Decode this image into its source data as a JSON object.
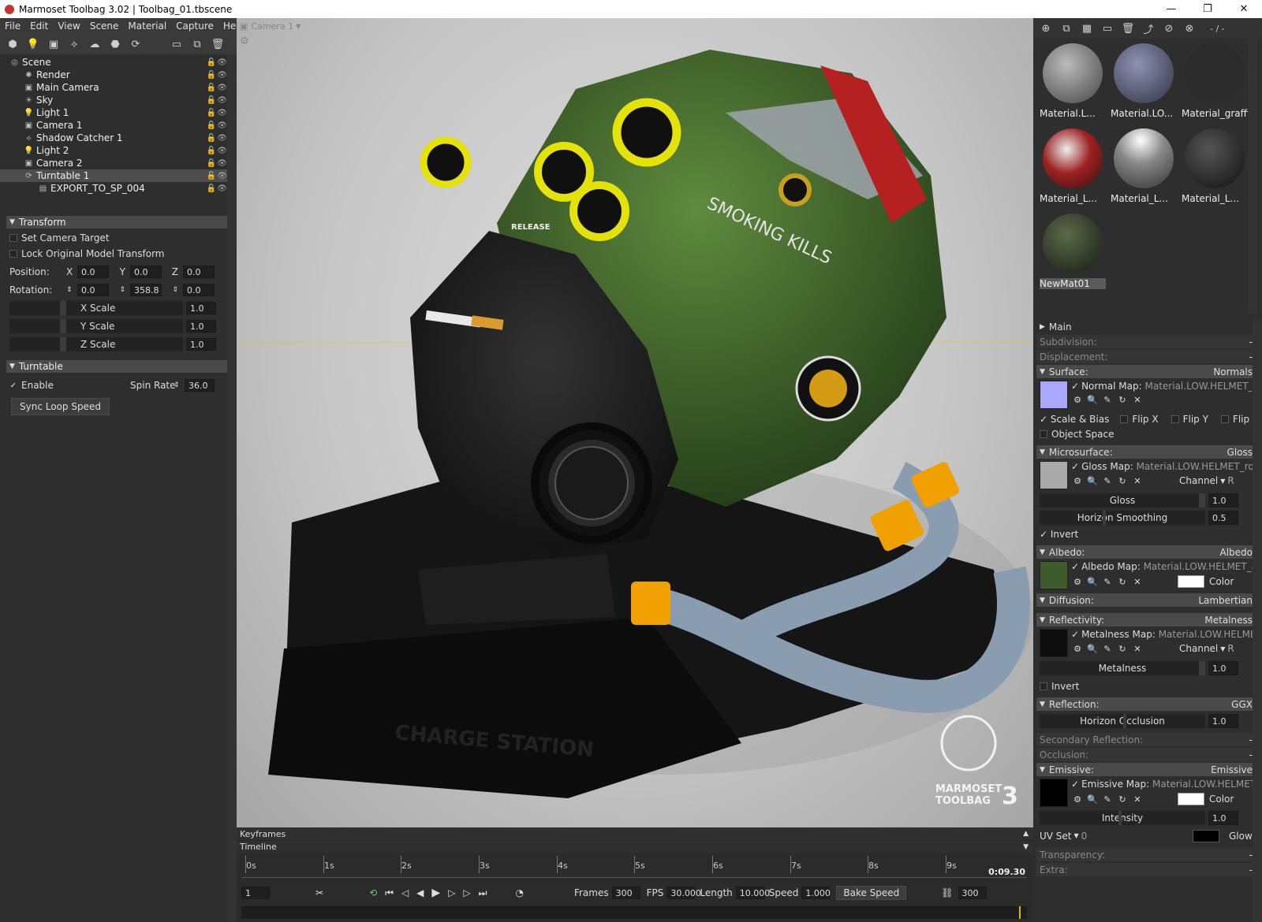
{
  "window": {
    "title": "Marmoset Toolbag 3.02  |  Toolbag_01.tbscene",
    "min": "—",
    "max": "❐",
    "close": "✕"
  },
  "menu": [
    "File",
    "Edit",
    "View",
    "Scene",
    "Material",
    "Capture",
    "Help"
  ],
  "scene_tree": [
    {
      "label": "Scene",
      "depth": 0,
      "icon": "scene-icon"
    },
    {
      "label": "Render",
      "depth": 1,
      "icon": "render-icon"
    },
    {
      "label": "Main Camera",
      "depth": 1,
      "icon": "camera-icon"
    },
    {
      "label": "Sky",
      "depth": 1,
      "icon": "sky-icon"
    },
    {
      "label": "Light 1",
      "depth": 1,
      "icon": "light-icon"
    },
    {
      "label": "Camera 1",
      "depth": 1,
      "icon": "camera-icon"
    },
    {
      "label": "Shadow Catcher 1",
      "depth": 1,
      "icon": "shadow-catcher-icon"
    },
    {
      "label": "Light 2",
      "depth": 1,
      "icon": "light-icon"
    },
    {
      "label": "Camera 2",
      "depth": 1,
      "icon": "camera-icon"
    },
    {
      "label": "Turntable 1",
      "depth": 1,
      "icon": "turntable-icon",
      "selected": true
    },
    {
      "label": "EXPORT_TO_SP_004",
      "depth": 2,
      "icon": "mesh-icon"
    }
  ],
  "transform": {
    "header": "Transform",
    "set_camera_target": "Set Camera Target",
    "lock_original": "Lock Original Model Transform",
    "position_label": "Position:",
    "rotation_label": "Rotation:",
    "x": "X",
    "y": "Y",
    "z": "Z",
    "position": [
      "0.0",
      "0.0",
      "0.0"
    ],
    "rotation": [
      "0.0",
      "358.8",
      "0.0"
    ],
    "x_scale_label": "X Scale",
    "x_scale": "1.0",
    "y_scale_label": "Y Scale",
    "y_scale": "1.0",
    "z_scale_label": "Z Scale",
    "z_scale": "1.0"
  },
  "turntable": {
    "header": "Turntable",
    "enable_label": "Enable",
    "enabled": true,
    "spin_rate_label": "Spin Rate",
    "spin_rate": "36.0",
    "sync_button": "Sync Loop Speed"
  },
  "viewport": {
    "camera": "Camera 1",
    "labels": {
      "release": "RELEASE",
      "graffiti": "SMOKING KILLS",
      "base_text": "CHARGE STATION",
      "watermark_1": "MARMOSET",
      "watermark_2": "TOOLBAG",
      "watermark_3": "3"
    }
  },
  "timeline": {
    "keyframes_label": "Keyframes",
    "timeline_label": "Timeline",
    "ticks": [
      "0s",
      "1s",
      "2s",
      "3s",
      "4s",
      "5s",
      "6s",
      "7s",
      "8s",
      "9s"
    ],
    "end_time": "0:09.30",
    "current_frame": "1",
    "frames_label": "Frames",
    "frames": "300",
    "fps_label": "FPS",
    "fps": "30.000",
    "length_label": "Length",
    "length": "10.000",
    "speed_label": "Speed",
    "speed": "1.000",
    "bake_button": "Bake Speed",
    "end_frame": "300"
  },
  "library": {
    "page": "- / -",
    "materials": [
      {
        "name": "Material.L...",
        "color": "#8a8a8a"
      },
      {
        "name": "Material.LO...",
        "color": "#6a6f86"
      },
      {
        "name": "Material_graffiti",
        "color": "#2a2a2a"
      },
      {
        "name": "Material_L...",
        "color": "#9c2222"
      },
      {
        "name": "Material_L...",
        "color": "#bdbdbd"
      },
      {
        "name": "Material_L...",
        "color": "#2d2d2d"
      },
      {
        "name": "NewMat01",
        "color": "#2f3a2c",
        "selected": true
      }
    ]
  },
  "material": {
    "main": "Main",
    "subdivision": "Subdivision:",
    "displacement": "Displacement:",
    "dash": "-",
    "surface": {
      "label": "Surface:",
      "value": "Normals",
      "map_label": "Normal Map:",
      "map": "Material.LOW.HELMET_no",
      "scale_bias": "Scale & Bias",
      "flip_x": "Flip X",
      "flip_y": "Flip Y",
      "flip_z": "Flip Z",
      "object_space": "Object Space"
    },
    "microsurface": {
      "label": "Microsurface:",
      "value": "Gloss",
      "map_label": "Gloss Map:",
      "map": "Material.LOW.HELMET_rough",
      "channel_label": "Channel",
      "channel": "R",
      "gloss_label": "Gloss",
      "gloss": "1.0",
      "horizon_label": "Horizon Smoothing",
      "horizon": "0.5",
      "invert": "Invert"
    },
    "albedo": {
      "label": "Albedo:",
      "value": "Albedo",
      "map_label": "Albedo Map:",
      "map": "Material.LOW.HELMET_alb",
      "color_label": "Color"
    },
    "diffusion": {
      "label": "Diffusion:",
      "value": "Lambertian"
    },
    "reflectivity": {
      "label": "Reflectivity:",
      "value": "Metalness",
      "map_label": "Metalness Map:",
      "map": "Material.LOW.HELMET_",
      "channel_label": "Channel",
      "channel": "R",
      "metal_label": "Metalness",
      "metal": "1.0",
      "invert": "Invert"
    },
    "reflection": {
      "label": "Reflection:",
      "value": "GGX",
      "occl_label": "Horizon Occlusion",
      "occl": "1.0"
    },
    "secondary_reflection": "Secondary Reflection:",
    "occlusion": "Occlusion:",
    "emissive": {
      "label": "Emissive:",
      "value": "Emissive",
      "map_label": "Emissive Map:",
      "map": "Material.LOW.HELMET_er",
      "color_label": "Color",
      "intensity_label": "Intensity",
      "intensity": "1.0",
      "uv_label": "UV Set",
      "uv": "0",
      "glow": "Glow"
    },
    "transparency": "Transparency:",
    "extra": "Extra:"
  }
}
